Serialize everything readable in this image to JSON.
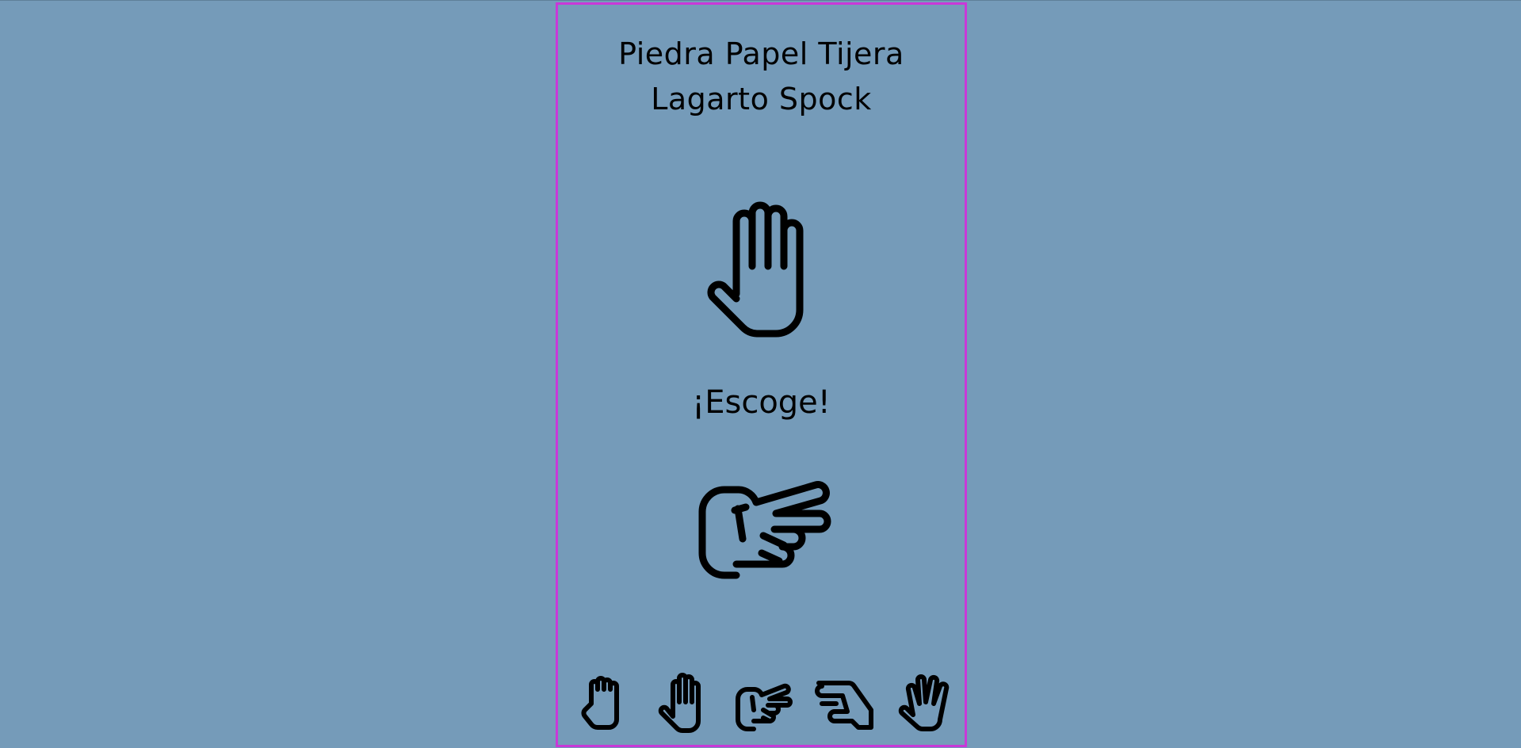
{
  "game": {
    "title_line1": "Piedra Papel Tijera",
    "title_line2": "Lagarto Spock",
    "prompt": "¡Escoge!",
    "player_pick_icon": "paper-hand-icon",
    "cpu_pick_icon": "scissors-hand-icon"
  },
  "choices": [
    {
      "id": "piedra",
      "icon": "rock-hand-icon"
    },
    {
      "id": "papel",
      "icon": "paper-hand-icon"
    },
    {
      "id": "tijera",
      "icon": "scissors-hand-icon"
    },
    {
      "id": "lagarto",
      "icon": "lizard-hand-icon"
    },
    {
      "id": "spock",
      "icon": "spock-hand-icon"
    }
  ],
  "colors": {
    "background": "#759bb9",
    "panel_border": "#c938d8",
    "ink": "#000000"
  }
}
